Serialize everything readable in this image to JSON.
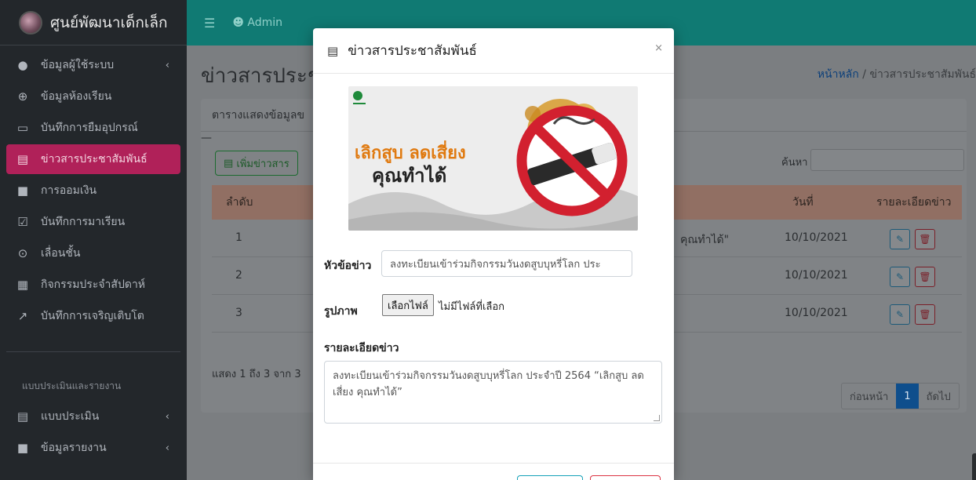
{
  "brand": {
    "name": "ศูนย์พัฒนาเด็กเล็ก"
  },
  "topbar": {
    "user": "Admin"
  },
  "sidebar": {
    "items": [
      {
        "label": "ข้อมูลผู้ใช้ระบบ",
        "icon": "user-circle-icon",
        "chevron": "‹"
      },
      {
        "label": "ข้อมูลห้องเรียน",
        "icon": "plus-circle-icon"
      },
      {
        "label": "บันทึกการยืมอุปกรณ์",
        "icon": "laptop-icon"
      },
      {
        "label": "ข่าวสารประชาสัมพันธ์",
        "icon": "newspaper-icon"
      },
      {
        "label": "การออมเงิน",
        "icon": "wallet-icon"
      },
      {
        "label": "บันทึกการมาเรียน",
        "icon": "calendar-check-icon"
      },
      {
        "label": "เลื่อนชั้น",
        "icon": "arrow-up-circle-icon"
      },
      {
        "label": "กิจกรรมประจำสัปดาห์",
        "icon": "calendar-icon"
      },
      {
        "label": "บันทึกการเจริญเติบโต",
        "icon": "chart-line-icon"
      }
    ],
    "section_header": "แบบประเมินและรายงาน",
    "bottom_items": [
      {
        "label": "แบบประเมิน",
        "icon": "clipboard-icon",
        "chevron": "‹"
      },
      {
        "label": "ข้อมูลรายงาน",
        "icon": "book-icon",
        "chevron": "‹"
      }
    ]
  },
  "page": {
    "title": "ข่าวสารประชา",
    "breadcrumb_home": "หน้าหลัก",
    "breadcrumb_sep": " / ",
    "breadcrumb_current": "ข่าวสารประชาสัมพันธ์"
  },
  "card": {
    "title": "ตารางแสดงข้อมูลข",
    "add_button": "เพิ่มข่าวสาร",
    "search_label": "ค้นหา",
    "col_order": "ลำดับ",
    "col_date": "วันที่",
    "col_detail": "รายละเอียดข่าว",
    "rows": [
      {
        "no": "1",
        "title_tail": "คุณทำได้\"",
        "date": "10/10/2021"
      },
      {
        "no": "2",
        "title_tail": "",
        "date": "10/10/2021"
      },
      {
        "no": "3",
        "title_tail": "",
        "date": "10/10/2021"
      }
    ],
    "showing": "แสดง 1 ถึง 3 จาก 3",
    "pager": {
      "prev": "ก่อนหน้า",
      "current": "1",
      "next": "ถัดไป"
    }
  },
  "modal": {
    "title": "ข่าวสารประชาสัมพันธ์",
    "close": "×",
    "image_caption_line1": "เลิกสูบ ลดเสี่ยง",
    "image_caption_line2": "คุณทำได้",
    "image_caption_accent": "#e07a10",
    "headline_label": "หัวข้อข่าว",
    "headline_value": "ลงทะเบียนเข้าร่วมกิจกรรมวันงดสูบบุหรี่โลก ประ",
    "image_label": "รูปภาพ",
    "file_button": "เลือกไฟล์",
    "file_note": "ไม่มีไฟล์ที่เลือก",
    "detail_label": "รายละเอียดข่าว",
    "detail_value": "ลงทะเบียนเข้าร่วมกิจกรรมวันงดสูบบุหรี่โลก ประจำปี 2564 “เลิกสูบ ลดเสี่ยง คุณทำได้”"
  },
  "colors": {
    "sidebar_bg": "#23272b",
    "sidebar_active": "#b02159",
    "topbar": "#107a73",
    "table_head": "#916f63",
    "pager_current": "#0e4e8c"
  }
}
